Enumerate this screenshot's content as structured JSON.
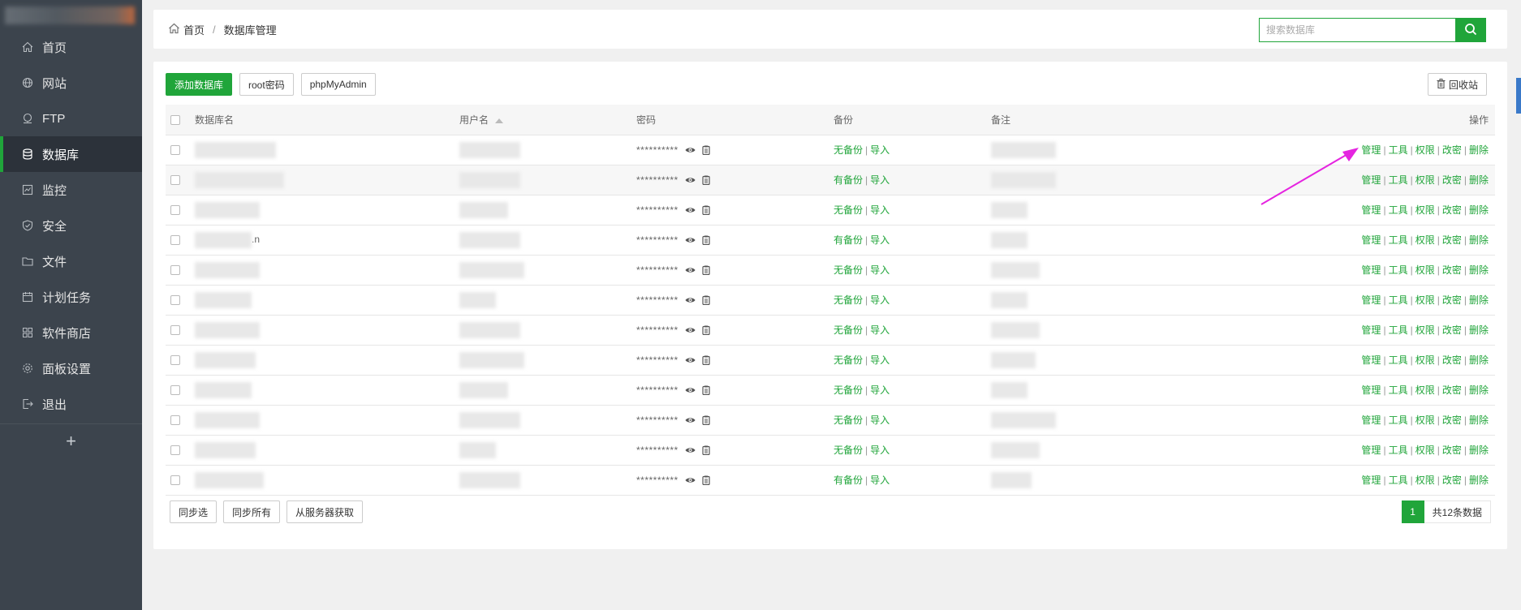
{
  "sidebar": {
    "items": [
      {
        "label": "首页",
        "icon": "home-icon"
      },
      {
        "label": "网站",
        "icon": "globe-icon"
      },
      {
        "label": "FTP",
        "icon": "ftp-icon"
      },
      {
        "label": "数据库",
        "icon": "database-icon",
        "active": true
      },
      {
        "label": "监控",
        "icon": "monitor-icon"
      },
      {
        "label": "安全",
        "icon": "shield-icon"
      },
      {
        "label": "文件",
        "icon": "folder-icon"
      },
      {
        "label": "计划任务",
        "icon": "calendar-icon"
      },
      {
        "label": "软件商店",
        "icon": "grid-icon"
      },
      {
        "label": "面板设置",
        "icon": "gear-icon"
      },
      {
        "label": "退出",
        "icon": "logout-icon"
      }
    ],
    "add_label": "+"
  },
  "breadcrumb": {
    "home": "首页",
    "sep": "/",
    "current": "数据库管理"
  },
  "search": {
    "placeholder": "搜索数据库"
  },
  "toolbar": {
    "add_db": "添加数据库",
    "root_pw": "root密码",
    "phpmyadmin": "phpMyAdmin",
    "recycle": "回收站"
  },
  "table": {
    "headers": {
      "name": "数据库名",
      "user": "用户名",
      "password": "密码",
      "backup": "备份",
      "notes": "备注",
      "ops": "操作"
    },
    "password_mask": "**********",
    "import_label": "导入",
    "op_labels": [
      "管理",
      "工具",
      "权限",
      "改密",
      "删除"
    ],
    "rows": [
      {
        "backup": "无备份",
        "name_suffix": ""
      },
      {
        "backup": "有备份",
        "name_suffix": ""
      },
      {
        "backup": "无备份",
        "name_suffix": ""
      },
      {
        "backup": "有备份",
        "name_suffix": ".n"
      },
      {
        "backup": "无备份",
        "name_suffix": ""
      },
      {
        "backup": "无备份",
        "name_suffix": ""
      },
      {
        "backup": "无备份",
        "name_suffix": ""
      },
      {
        "backup": "无备份",
        "name_suffix": ""
      },
      {
        "backup": "无备份",
        "name_suffix": ""
      },
      {
        "backup": "无备份",
        "name_suffix": ""
      },
      {
        "backup": "无备份",
        "name_suffix": ""
      },
      {
        "backup": "有备份",
        "name_suffix": ""
      }
    ]
  },
  "footer": {
    "sync_selected": "同步选",
    "sync_all": "同步所有",
    "fetch_server": "从服务器获取"
  },
  "pager": {
    "current": "1",
    "total": "共12条数据"
  },
  "colors": {
    "accent": "#20a53a",
    "sidebar": "#3c444d",
    "arrow": "#e524e0"
  }
}
